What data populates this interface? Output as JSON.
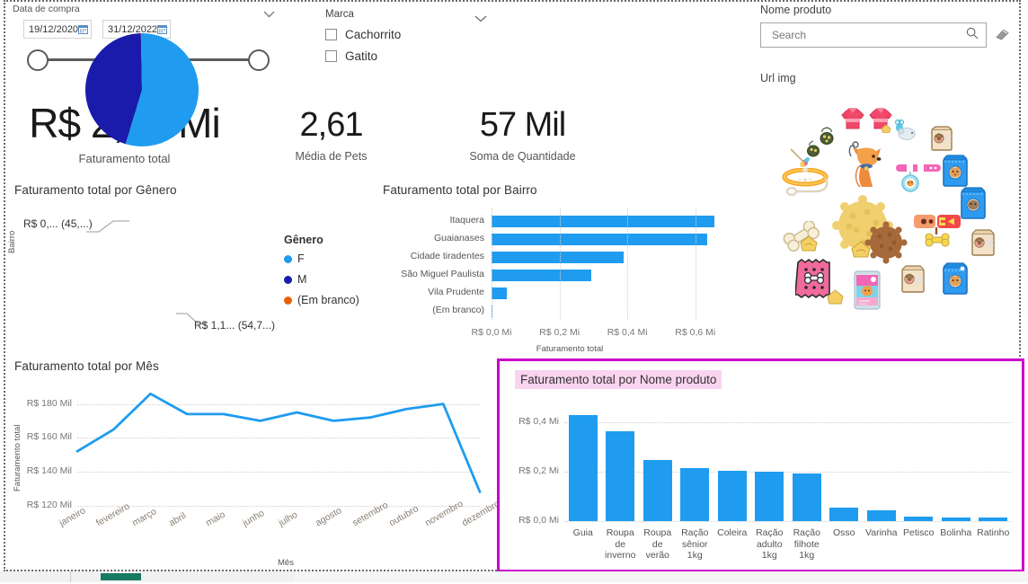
{
  "date_slicer": {
    "name": "Data de compra",
    "start": "19/12/2020",
    "end": "31/12/2022"
  },
  "marca_slicer": {
    "name": "Marca",
    "items": [
      {
        "label": "Cachorrito",
        "checked": false
      },
      {
        "label": "Gatito",
        "checked": false
      }
    ]
  },
  "search_slicer": {
    "name": "Nome produto",
    "placeholder": "Search",
    "value": ""
  },
  "urlimg": {
    "title": "Url img"
  },
  "kpis": [
    {
      "value": "R$ 2,03 Mi",
      "caption": "Faturamento total"
    },
    {
      "value": "2,61",
      "caption": "Média de Pets"
    },
    {
      "value": "57 Mil",
      "caption": "Soma de Quantidade"
    }
  ],
  "colors": {
    "accent_blue": "#1f9cf0",
    "dark_navy": "#1a1bab",
    "orange": "#e8620c",
    "selection_magenta": "#cc00cc",
    "title_highlight": "#f9d4f0"
  },
  "chart_data": [
    {
      "type": "pie",
      "title": "Faturamento total por Gênero",
      "legend_title": "Gênero",
      "legend_position": "right",
      "labels": [
        "F",
        "M",
        "(Em branco)"
      ],
      "values": [
        54.7,
        45.0,
        0.3
      ],
      "colors": [
        "#1f9cf0",
        "#1a1bab",
        "#e8620c"
      ],
      "data_labels": [
        "R$ 1,1... (54,7...)",
        "R$ 0,... (45,...)"
      ]
    },
    {
      "type": "bar",
      "orientation": "horizontal",
      "title": "Faturamento total por Bairro",
      "xlabel": "Faturamento total",
      "ylabel": "Bairro",
      "categories": [
        "Itaquera",
        "Guaianases",
        "Cidade tiradentes",
        "São Miguel Paulista",
        "Vila Prudente",
        "(Em branco)"
      ],
      "values": [
        0.655,
        0.635,
        0.39,
        0.295,
        0.045,
        0.0
      ],
      "xlim": [
        0,
        0.68
      ],
      "xticks": [
        0,
        0.2,
        0.4,
        0.6
      ],
      "xticklabels": [
        "R$ 0,0 Mi",
        "R$ 0,2 Mi",
        "R$ 0,4 Mi",
        "R$ 0,6 Mi"
      ],
      "grid": true
    },
    {
      "type": "line",
      "title": "Faturamento total por Mês",
      "xlabel": "Mês",
      "ylabel": "Faturamento total",
      "categories": [
        "janeiro",
        "fevereiro",
        "março",
        "abril",
        "maio",
        "junho",
        "julho",
        "agosto",
        "setembro",
        "outubro",
        "novembro",
        "dezembro"
      ],
      "values": [
        152,
        165,
        186,
        174,
        174,
        170,
        175,
        170,
        172,
        177,
        180,
        128
      ],
      "ylim": [
        115,
        192
      ],
      "yticks": [
        120,
        140,
        160,
        180
      ],
      "yticklabels": [
        "R$ 120 Mil",
        "R$ 140 Mil",
        "R$ 160 Mil",
        "R$ 180 Mil"
      ],
      "grid": true,
      "line_color": "#1f9cf0"
    },
    {
      "type": "bar",
      "orientation": "vertical",
      "title": "Faturamento total por Nome produto",
      "selected": true,
      "categories": [
        "Guia",
        "Roupa\nde\ninverno",
        "Roupa\nde\nverão",
        "Ração\nsênior\n1kg",
        "Coleira",
        "Ração\nadulto\n1kg",
        "Ração\nfilhote\n1kg",
        "Osso",
        "Varinha",
        "Petisco",
        "Bolinha",
        "Ratinho"
      ],
      "values": [
        0.43,
        0.365,
        0.25,
        0.215,
        0.205,
        0.2,
        0.195,
        0.055,
        0.045,
        0.018,
        0.016,
        0.014
      ],
      "ylim": [
        0,
        0.46
      ],
      "yticks": [
        0,
        0.2,
        0.4
      ],
      "yticklabels": [
        "R$ 0,0 Mi",
        "R$ 0,2 Mi",
        "R$ 0,4 Mi"
      ],
      "grid": true,
      "bar_color": "#1f9cf0"
    }
  ]
}
